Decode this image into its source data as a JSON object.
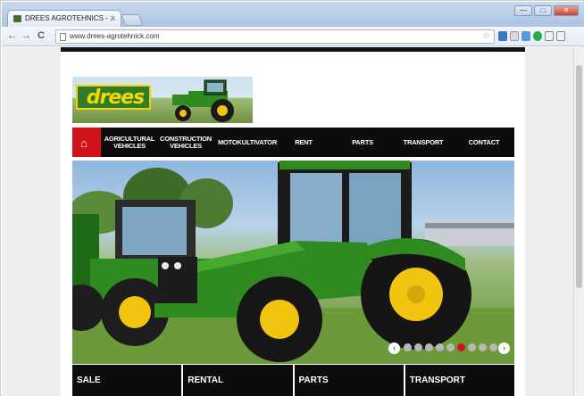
{
  "browser": {
    "tab_title": "DREES AGROTEHNICS - ...",
    "tab_close": "×",
    "back": "←",
    "forward": "→",
    "reload": "C",
    "url": "www.drees-agrotehnick.com",
    "star": "☆",
    "minimize": "—",
    "maximize": "□",
    "close": "✕"
  },
  "logo": {
    "text": "drees"
  },
  "nav": {
    "home_icon": "home-icon",
    "items": [
      {
        "label": "AGRICULTURAL VEHICLES"
      },
      {
        "label": "CONSTRUCTION VEHICLES"
      },
      {
        "label": "MOTOKULTIVATOR"
      },
      {
        "label": "RENT"
      },
      {
        "label": "PARTS"
      },
      {
        "label": "TRANSPORT"
      },
      {
        "label": "CONTACT"
      }
    ]
  },
  "slider": {
    "prev": "‹",
    "next": "›",
    "total_slides": 10,
    "active_slide": 6
  },
  "categories": [
    {
      "label": "SALE"
    },
    {
      "label": "RENTAL"
    },
    {
      "label": "PARTS"
    },
    {
      "label": "TRANSPORT"
    }
  ],
  "colors": {
    "accent_red": "#d3121b",
    "nav_black": "#0c0c0c",
    "tractor_green": "#2f8a1f",
    "tractor_yellow": "#f1c40f"
  }
}
